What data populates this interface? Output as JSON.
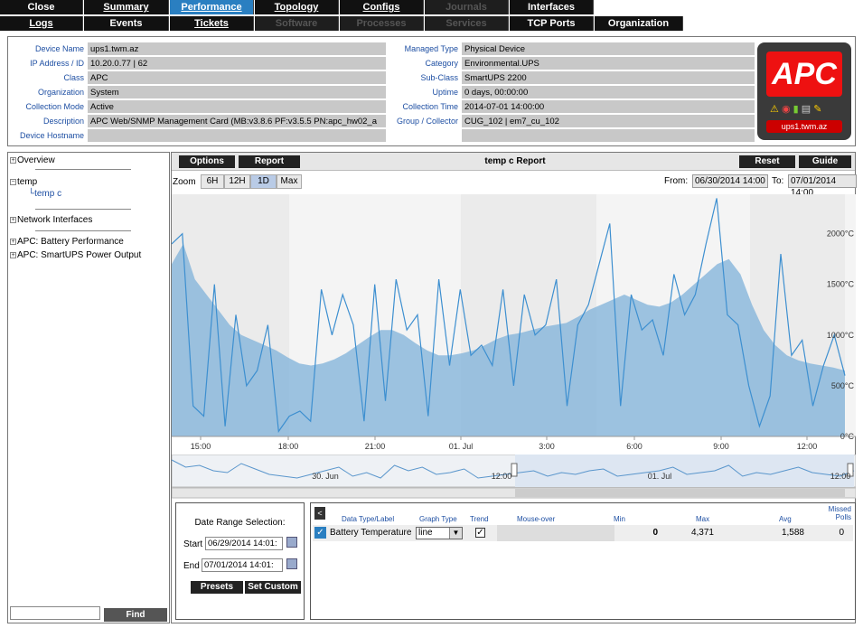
{
  "nav": {
    "row1": [
      {
        "label": "Close",
        "state": "normal"
      },
      {
        "label": "Summary",
        "state": "normal"
      },
      {
        "label": "Performance",
        "state": "active"
      },
      {
        "label": "Topology",
        "state": "normal"
      },
      {
        "label": "Configs",
        "state": "normal"
      },
      {
        "label": "Journals",
        "state": "disabled"
      },
      {
        "label": "Interfaces",
        "state": "normal"
      }
    ],
    "row2": [
      {
        "label": "Logs",
        "state": "normal"
      },
      {
        "label": "Events",
        "state": "normal"
      },
      {
        "label": "Tickets",
        "state": "normal"
      },
      {
        "label": "Software",
        "state": "disabled"
      },
      {
        "label": "Processes",
        "state": "disabled"
      },
      {
        "label": "Services",
        "state": "disabled"
      },
      {
        "label": "TCP Ports",
        "state": "normal"
      },
      {
        "label": "Organization",
        "state": "normal"
      }
    ]
  },
  "device": {
    "left": [
      {
        "label": "Device Name",
        "value": "ups1.twm.az"
      },
      {
        "label": "IP Address / ID",
        "value": "10.20.0.77 | 62"
      },
      {
        "label": "Class",
        "value": "APC"
      },
      {
        "label": "Organization",
        "value": "System"
      },
      {
        "label": "Collection Mode",
        "value": "Active"
      },
      {
        "label": "Description",
        "value": "APC Web/SNMP Management Card (MB:v3.8.6 PF:v3.5.5 PN:apc_hw02_a"
      },
      {
        "label": "Device Hostname",
        "value": ""
      }
    ],
    "right": [
      {
        "label": "Managed Type",
        "value": "Physical Device"
      },
      {
        "label": "Category",
        "value": "Environmental.UPS"
      },
      {
        "label": "Sub-Class",
        "value": "SmartUPS 2200"
      },
      {
        "label": "Uptime",
        "value": "0 days, 00:00:00"
      },
      {
        "label": "Collection Time",
        "value": "2014-07-01 14:00:00"
      },
      {
        "label": "Group / Collector",
        "value": "CUG_102 | em7_cu_102"
      }
    ],
    "logo_text": "APC",
    "logo_device": "ups1.twm.az"
  },
  "tree": {
    "overview": "Overview",
    "temp": "temp",
    "temp_child": "temp c",
    "network": "Network Interfaces",
    "battery": "APC: Battery Performance",
    "smartups": "APC: SmartUPS Power Output",
    "find_label": "Find",
    "find_value": ""
  },
  "report": {
    "options_label": "Options",
    "report_label": "Report",
    "title": "temp c Report",
    "reset_label": "Reset",
    "guide_label": "Guide",
    "zoom_label": "Zoom",
    "zoom_options": [
      "6H",
      "12H",
      "1D",
      "Max"
    ],
    "zoom_selected": "1D",
    "from_label": "From:",
    "from_value": "06/30/2014 14:00",
    "to_label": "To:",
    "to_value": "07/01/2014 14:00"
  },
  "chart_data": {
    "type": "area",
    "title": "",
    "xlabel": "",
    "ylabel": "",
    "x_ticks": [
      "15:00",
      "18:00",
      "21:00",
      "01. Jul",
      "3:00",
      "6:00",
      "9:00",
      "12:00"
    ],
    "y_ticks": [
      "0°C",
      "500°C",
      "1000°C",
      "1500°C",
      "2000°C"
    ],
    "ylim": [
      0,
      2300
    ],
    "series": [
      {
        "values": [
          1700,
          1900,
          1550,
          1400,
          1250,
          1100,
          1000,
          950,
          900,
          850,
          780,
          720,
          700,
          720,
          760,
          820,
          900,
          980,
          1050,
          1050,
          1000,
          920,
          850,
          800,
          800,
          820,
          850,
          900,
          960,
          1000,
          1020,
          1050,
          1080,
          1100,
          1120,
          1180,
          1250,
          1300,
          1350,
          1400,
          1350,
          1300,
          1280,
          1320,
          1400,
          1500,
          1600,
          1700,
          1750,
          1600,
          1300,
          1050,
          900,
          800,
          750,
          720,
          700,
          680,
          650
        ]
      },
      {
        "values": [
          1900,
          2000,
          300,
          200,
          1500,
          100,
          1200,
          500,
          650,
          1100,
          50,
          200,
          250,
          150,
          1450,
          1000,
          1400,
          1100,
          150,
          1500,
          350,
          1550,
          1050,
          1200,
          200,
          1550,
          700,
          1450,
          800,
          900,
          700,
          1450,
          500,
          1400,
          1000,
          1100,
          1550,
          300,
          1100,
          1300,
          1700,
          2100,
          300,
          1400,
          1050,
          1150,
          800,
          1600,
          1200,
          1400,
          1900,
          2350,
          1200,
          1100,
          500,
          100,
          400,
          1800,
          800,
          950,
          300,
          700,
          1000,
          600
        ]
      }
    ]
  },
  "navigator": {
    "labels": [
      "30. Jun",
      "12:00",
      "01. Jul",
      "12:00"
    ]
  },
  "date_range": {
    "heading": "Date Range Selection:",
    "start_label": "Start",
    "start_value": "06/29/2014 14:01:",
    "end_label": "End",
    "end_value": "07/01/2014 14:01:",
    "presets_label": "Presets",
    "custom_label": "Set Custom"
  },
  "table": {
    "headers": [
      "Data Type/Label",
      "Graph Type",
      "Trend",
      "Mouse-over",
      "Min",
      "Max",
      "Avg",
      "Missed Polls"
    ],
    "row": {
      "label": "Battery Temperature",
      "graph_type": "line",
      "min": "0",
      "max": "4,371",
      "avg": "1,588",
      "missed": "0"
    },
    "collapse_label": "<"
  }
}
